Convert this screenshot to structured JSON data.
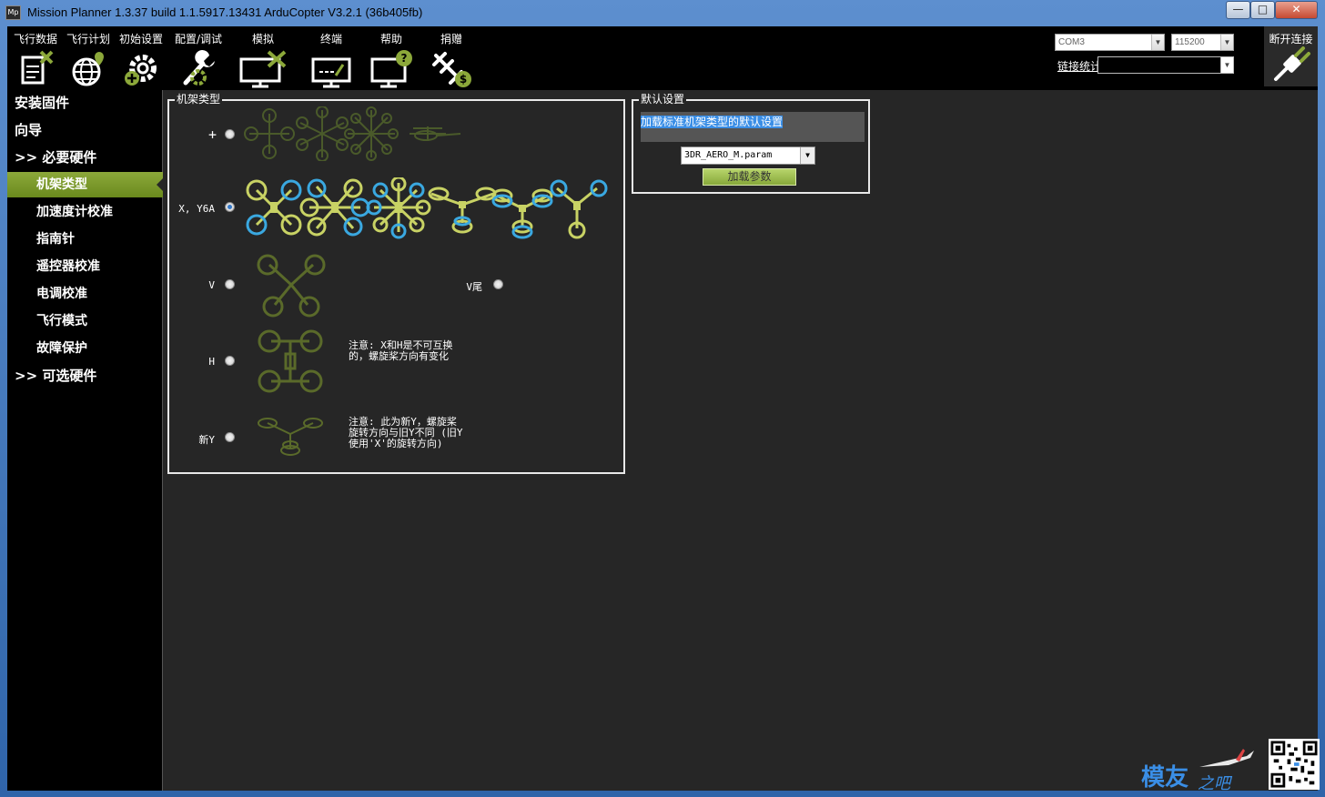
{
  "window": {
    "title": "Mission Planner 1.3.37 build 1.1.5917.13431 ArduCopter V3.2.1 (36b405fb)",
    "app_icon_text": "Mp",
    "controls": {
      "minimize": "—",
      "maximize": "□",
      "close": "✕"
    }
  },
  "toolbar": {
    "items": [
      {
        "label": "飞行数据",
        "icon": "flight-data-icon"
      },
      {
        "label": "飞行计划",
        "icon": "flight-plan-icon"
      },
      {
        "label": "初始设置",
        "icon": "initial-setup-icon"
      },
      {
        "label": "配置/调试",
        "icon": "config-tuning-icon"
      },
      {
        "label": "模拟",
        "icon": "simulation-icon"
      },
      {
        "label": "终端",
        "icon": "terminal-icon"
      },
      {
        "label": "帮助",
        "icon": "help-icon"
      },
      {
        "label": "捐赠",
        "icon": "donate-icon"
      }
    ],
    "port_value": "COM3",
    "baud_value": "115200",
    "link_stats_label": "链接统计",
    "disconnect_label": "断开连接"
  },
  "sidebar": {
    "items": [
      {
        "label": "安装固件",
        "level": "top"
      },
      {
        "label": "向导",
        "level": "top"
      },
      {
        "label": ">> 必要硬件",
        "level": "top"
      },
      {
        "label": "机架类型",
        "level": "sub",
        "active": true
      },
      {
        "label": "加速度计校准",
        "level": "sub"
      },
      {
        "label": "指南针",
        "level": "sub"
      },
      {
        "label": "遥控器校准",
        "level": "sub"
      },
      {
        "label": "电调校准",
        "level": "sub"
      },
      {
        "label": "飞行模式",
        "level": "sub"
      },
      {
        "label": "故障保护",
        "level": "sub"
      },
      {
        "label": ">> 可选硬件",
        "level": "top"
      }
    ]
  },
  "frame_type": {
    "legend": "机架类型",
    "rows": [
      {
        "label": "+",
        "checked": false
      },
      {
        "label": "X, Y6A",
        "checked": true
      },
      {
        "label": "V",
        "checked": false
      },
      {
        "label": "V尾",
        "checked": false
      },
      {
        "label": "H",
        "checked": false
      },
      {
        "label": "新Y",
        "checked": false
      }
    ],
    "note_h": "注意: X和H是不可互换\n的，螺旋桨方向有变化",
    "note_newy": "注意: 此为新Y，螺旋桨\n旋转方向与旧Y不同 (旧Y\n使用'X'的旋转方向)"
  },
  "defaults": {
    "legend": "默认设置",
    "description": "加载标准机架类型的默认设置",
    "param_file": "3DR_AERO_M.param",
    "load_button": "加载参数"
  },
  "colors": {
    "accent_green": "#8ca83a",
    "prop_cw": "#c8d264",
    "prop_ccw": "#3aa8e0",
    "dim_frame": "#5a6a2a"
  }
}
